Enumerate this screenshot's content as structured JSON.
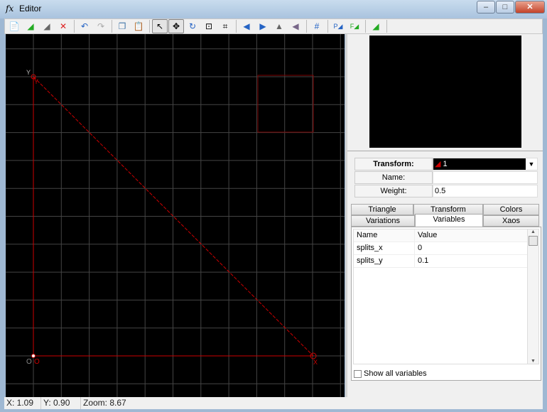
{
  "window": {
    "title": "Editor",
    "icon": "fx-icon"
  },
  "toolbar": {
    "buttons": [
      "new-icon",
      "add-transform-icon",
      "duplicate-icon",
      "delete-icon",
      "undo-icon",
      "redo-icon",
      "copy-icon",
      "paste-icon",
      "select-pointer-icon",
      "move-icon",
      "rotate-icon",
      "scale-icon",
      "flip-icon",
      "rotate-left-icon",
      "rotate-right-icon",
      "flip-horizontal-icon",
      "flip-vertical-icon",
      "grid-icon",
      "post-transform-icon",
      "final-transform-icon",
      "add-linked-icon"
    ]
  },
  "canvas": {
    "labels": {
      "y": "Y",
      "x": "X",
      "o": "O",
      "o_gray": "O",
      "y_ref": "Y"
    },
    "colors": {
      "transform": "#cc0000",
      "grid": "#444444",
      "background": "#000000"
    }
  },
  "transform": {
    "label": "Transform:",
    "value": "1",
    "name_label": "Name:",
    "name_value": "",
    "weight_label": "Weight:",
    "weight_value": "0.5"
  },
  "tabs": {
    "row1": [
      "Triangle",
      "Transform",
      "Colors"
    ],
    "row2": [
      "Variations",
      "Variables",
      "Xaos"
    ],
    "active": "Variables"
  },
  "variables": {
    "headers": [
      "Name",
      "Value"
    ],
    "rows": [
      {
        "name": "splits_x",
        "value": "0"
      },
      {
        "name": "splits_y",
        "value": "0.1"
      }
    ],
    "show_all_label": "Show all variables",
    "show_all_checked": false
  },
  "status": {
    "x": "X: 1.09",
    "y": "Y: 0.90",
    "zoom": "Zoom: 8.67"
  }
}
